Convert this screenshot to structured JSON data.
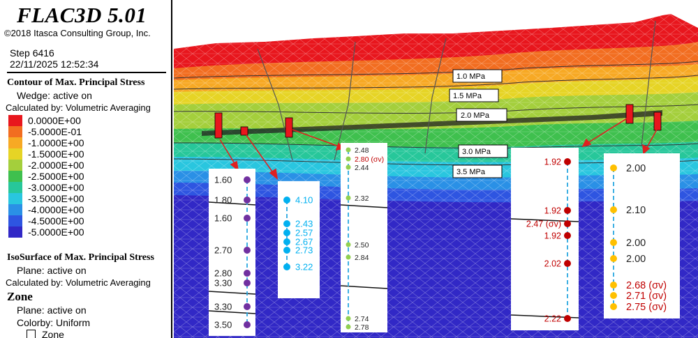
{
  "header": {
    "title": "FLAC3D 5.01",
    "copyright": "©2018 Itasca Consulting Group, Inc.",
    "step": "Step 6416",
    "datetime": "22/11/2025 12:52:34"
  },
  "contour": {
    "title": "Contour of Max. Principal Stress",
    "line1": "Wedge: active on",
    "line2": "Calculated by: Volumetric Averaging",
    "items": [
      {
        "label": "0.0000E+00",
        "color": "#e8161d"
      },
      {
        "label": "-5.0000E-01",
        "color": "#f26d20"
      },
      {
        "label": "-1.0000E+00",
        "color": "#f7a924"
      },
      {
        "label": "-1.5000E+00",
        "color": "#e6d425"
      },
      {
        "label": "-2.0000E+00",
        "color": "#a4cf3c"
      },
      {
        "label": "-2.5000E+00",
        "color": "#3fc04e"
      },
      {
        "label": "-3.0000E+00",
        "color": "#27c79a"
      },
      {
        "label": "-3.5000E+00",
        "color": "#29c6df"
      },
      {
        "label": "-4.0000E+00",
        "color": "#2a90e6"
      },
      {
        "label": "-4.5000E+00",
        "color": "#2e55e1"
      },
      {
        "label": "-5.0000E+00",
        "color": "#3128c6"
      }
    ]
  },
  "isosurface": {
    "title": "IsoSurface of Max. Principal Stress",
    "line1": "Plane: active on",
    "line2": "Calculated by: Volumetric Averaging"
  },
  "zone": {
    "title": "Zone",
    "line1": "Plane: active on",
    "line2": "Colorby: Uniform",
    "line3": "Zone"
  },
  "contour_labels": [
    "1.0 MPa",
    "1.5 MPa",
    "2.0 MPa",
    "3.0 MPa",
    "3.5 MPa"
  ],
  "panels": [
    {
      "color": "#7030a0",
      "values": [
        "1.60",
        "1.80",
        "1.60",
        "2.70",
        "2.80",
        "3.30",
        "3.30",
        "3.50"
      ]
    },
    {
      "color": "#00b0f0",
      "values": [
        "4.10",
        "2.43",
        "2.57",
        "2.67",
        "2.73",
        "3.22"
      ]
    },
    {
      "color": "#92d050",
      "values": [
        "2.48",
        "2.80 (σv)",
        "2.44",
        "2.32",
        "2.50",
        "2.84",
        "2.74",
        "2.78"
      ]
    },
    {
      "color": "#c00000",
      "values": [
        "1.92",
        "1.92",
        "2.47 (σv)",
        "1.92",
        "2.02",
        "2.22"
      ]
    },
    {
      "color": "#ffc000",
      "values": [
        "2.00",
        "2.10",
        "2.00",
        "2.00",
        "2.68 (σv)",
        "2.71 (σv)",
        "2.75 (σv)"
      ]
    }
  ]
}
